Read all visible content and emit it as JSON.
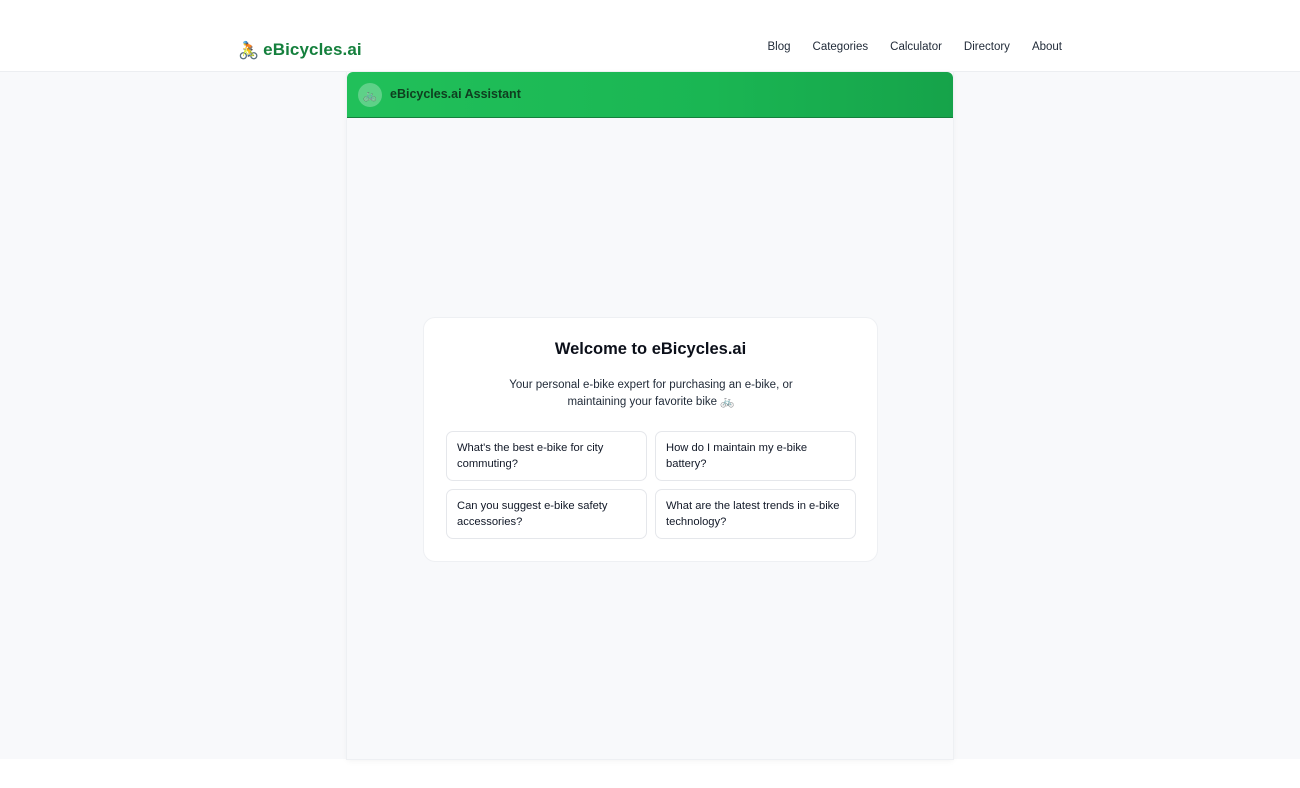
{
  "brand": {
    "icon": "🚴",
    "name": "eBicycles.ai"
  },
  "nav": {
    "items": [
      "Blog",
      "Categories",
      "Calculator",
      "Directory",
      "About"
    ]
  },
  "assistant": {
    "avatar_icon": "🚲",
    "title": "eBicycles.ai Assistant"
  },
  "welcome": {
    "title": "Welcome to eBicycles.ai",
    "subtitle": "Your personal e-bike expert for purchasing an e-bike, or maintaining your favorite bike 🚲",
    "suggestions": [
      "What's the best e-bike for city commuting?",
      "How do I maintain my e-bike battery?",
      "Can you suggest e-bike safety accessories?",
      "What are the latest trends in e-bike technology?"
    ]
  },
  "colors": {
    "brand_green": "#15803d",
    "header_gradient_start": "#21c05a",
    "header_gradient_end": "#16a34a",
    "page_bg": "#f8f9fb"
  }
}
